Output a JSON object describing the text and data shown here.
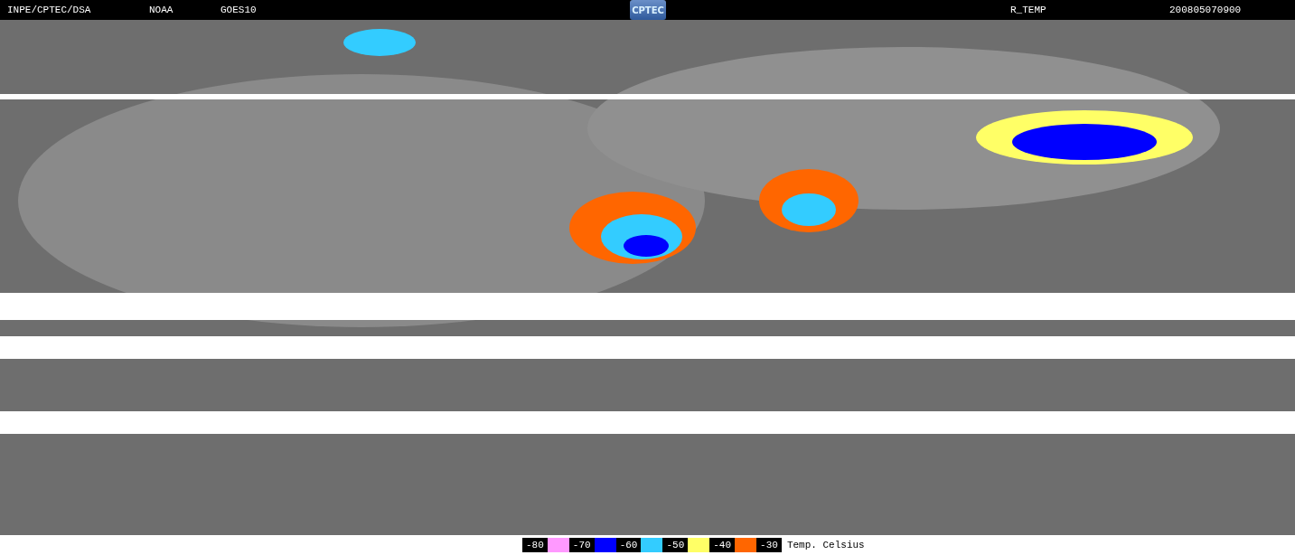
{
  "header": {
    "agency": "INPE/CPTEC/DSA",
    "source": "NOAA",
    "satellite": "GOES10",
    "logo": "CPTEC",
    "product": "R_TEMP",
    "timestamp": "200805070900"
  },
  "legend": {
    "items": [
      {
        "label": "-80",
        "color": "#ff99ff"
      },
      {
        "label": "-70",
        "color": "#0000ff"
      },
      {
        "label": "-60",
        "color": "#33ccff"
      },
      {
        "label": "-50",
        "color": "#ffff66"
      },
      {
        "label": "-40",
        "color": "#ff6600"
      },
      {
        "label": "-30"
      }
    ],
    "unit": "Temp. Celsius"
  }
}
